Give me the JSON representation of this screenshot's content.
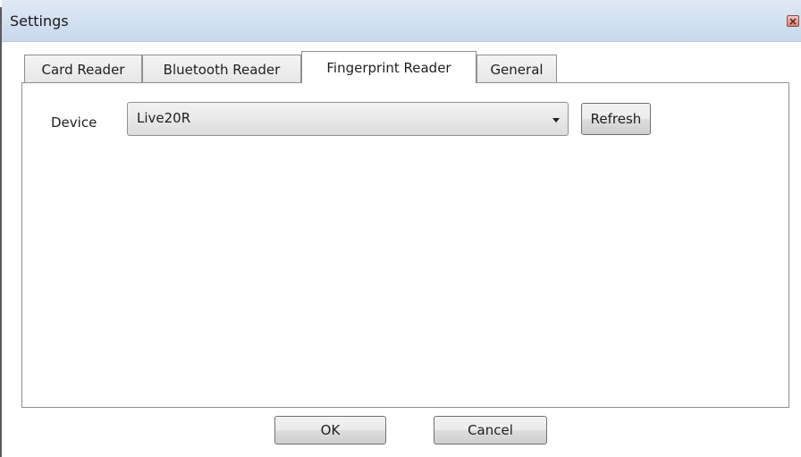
{
  "window": {
    "title": "Settings"
  },
  "tabs": [
    {
      "label": "Card Reader",
      "active": false
    },
    {
      "label": "Bluetooth Reader",
      "active": false
    },
    {
      "label": "Fingerprint Reader",
      "active": true
    },
    {
      "label": "General",
      "active": false
    }
  ],
  "fingerprint": {
    "device_label": "Device",
    "device_value": "Live20R",
    "refresh_label": "Refresh"
  },
  "footer": {
    "ok_label": "OK",
    "cancel_label": "Cancel"
  },
  "icons": {
    "close": "close-icon",
    "dropdown": "chevron-down-icon"
  },
  "colors": {
    "titlebar": "#d0dfef",
    "close_button": "#d98574",
    "border": "#8e8f8f"
  }
}
